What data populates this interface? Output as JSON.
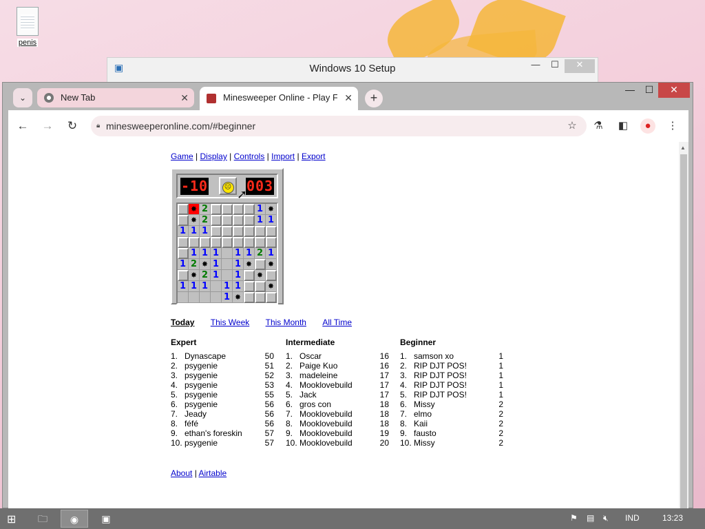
{
  "desktop": {
    "icon_label": "penis"
  },
  "setup_window": {
    "title": "Windows 10 Setup",
    "minimize": "—",
    "maximize": "☐",
    "close": "✕"
  },
  "browser": {
    "tabs": [
      {
        "label": "New Tab",
        "close": "✕"
      },
      {
        "label": "Minesweeper Online - Play Free",
        "close": "✕"
      }
    ],
    "new_tab": "+",
    "tab_search": "⌄",
    "window_controls": {
      "minimize": "—",
      "maximize": "☐",
      "close": "✕"
    },
    "toolbar": {
      "back": "←",
      "forward": "→",
      "reload": "↻",
      "url": "minesweeperonline.com/#beginner",
      "star": "☆",
      "labs": "⚗",
      "sidepanel": "◧",
      "menu": "⋮"
    }
  },
  "page": {
    "menu": [
      {
        "label": "Game"
      },
      {
        "label": "Display"
      },
      {
        "label": "Controls"
      },
      {
        "label": "Import"
      },
      {
        "label": "Export"
      }
    ],
    "mine_counter": "-10",
    "timer": "003",
    "board": [
      [
        "c",
        "mh",
        "2",
        "c",
        "c",
        "c",
        "c",
        "1",
        "m"
      ],
      [
        "c",
        "m",
        "2",
        "c",
        "c",
        "c",
        "c",
        "1",
        "1"
      ],
      [
        "1",
        "1",
        "1",
        "c",
        "c",
        "c",
        "c",
        "c",
        "c"
      ],
      [
        "c",
        "c",
        "c",
        "c",
        "c",
        "c",
        "c",
        "c",
        "c"
      ],
      [
        "c",
        "1",
        "1",
        "1",
        "e",
        "1",
        "1",
        "2",
        "1"
      ],
      [
        "1",
        "2",
        "m",
        "1",
        "e",
        "1",
        "m",
        "c",
        "m"
      ],
      [
        "c",
        "m",
        "2",
        "1",
        "e",
        "1",
        "c",
        "m",
        "c"
      ],
      [
        "1",
        "1",
        "1",
        "e",
        "1",
        "1",
        "c",
        "c",
        "m"
      ],
      [
        "e",
        "e",
        "e",
        "e",
        "1",
        "m",
        "c",
        "c",
        "c"
      ]
    ],
    "periods": {
      "current": "Today",
      "links": [
        "This Week",
        "This Month",
        "All Time"
      ]
    },
    "leaderboards": [
      {
        "title": "Expert",
        "rows": [
          {
            "rank": "1.",
            "name": "Dynascape",
            "score": "50"
          },
          {
            "rank": "2.",
            "name": "psygenie",
            "score": "51"
          },
          {
            "rank": "3.",
            "name": "psygenie",
            "score": "52"
          },
          {
            "rank": "4.",
            "name": "psygenie",
            "score": "53"
          },
          {
            "rank": "5.",
            "name": "psygenie",
            "score": "55"
          },
          {
            "rank": "6.",
            "name": "psygenie",
            "score": "56"
          },
          {
            "rank": "7.",
            "name": "Jeady",
            "score": "56"
          },
          {
            "rank": "8.",
            "name": "féfé",
            "score": "56"
          },
          {
            "rank": "9.",
            "name": "ethan's foreskin",
            "score": "57"
          },
          {
            "rank": "10.",
            "name": "psygenie",
            "score": "57"
          }
        ]
      },
      {
        "title": "Intermediate",
        "rows": [
          {
            "rank": "1.",
            "name": "Oscar",
            "score": "16"
          },
          {
            "rank": "2.",
            "name": "Paige Kuo",
            "score": "16"
          },
          {
            "rank": "3.",
            "name": "madeleine",
            "score": "17"
          },
          {
            "rank": "4.",
            "name": "Mooklovebuild",
            "score": "17"
          },
          {
            "rank": "5.",
            "name": "Jack",
            "score": "17"
          },
          {
            "rank": "6.",
            "name": "gros con",
            "score": "18"
          },
          {
            "rank": "7.",
            "name": "Mooklovebuild",
            "score": "18"
          },
          {
            "rank": "8.",
            "name": "Mooklovebuild",
            "score": "18"
          },
          {
            "rank": "9.",
            "name": "Mooklovebuild",
            "score": "19"
          },
          {
            "rank": "10.",
            "name": "Mooklovebuild",
            "score": "20"
          }
        ]
      },
      {
        "title": "Beginner",
        "rows": [
          {
            "rank": "1.",
            "name": "samson xo",
            "score": "1"
          },
          {
            "rank": "2.",
            "name": "RIP DJT POS!",
            "score": "1"
          },
          {
            "rank": "3.",
            "name": "RIP DJT POS!",
            "score": "1"
          },
          {
            "rank": "4.",
            "name": "RIP DJT POS!",
            "score": "1"
          },
          {
            "rank": "5.",
            "name": "RIP DJT POS!",
            "score": "1"
          },
          {
            "rank": "6.",
            "name": "Missy",
            "score": "2"
          },
          {
            "rank": "7.",
            "name": "elmo",
            "score": "2"
          },
          {
            "rank": "8.",
            "name": "Kaii",
            "score": "2"
          },
          {
            "rank": "9.",
            "name": "fausto",
            "score": "2"
          },
          {
            "rank": "10.",
            "name": "Missy",
            "score": "2"
          }
        ]
      }
    ],
    "footer": {
      "about": "About",
      "separator": "|",
      "airtable": "Airtable"
    }
  },
  "taskbar": {
    "start_icon": "start-icon",
    "language": "IND",
    "time": "13:23"
  },
  "colors": {
    "link": "#0000cc",
    "lcd_red": "#ff2a1a",
    "close_red": "#c84747"
  }
}
